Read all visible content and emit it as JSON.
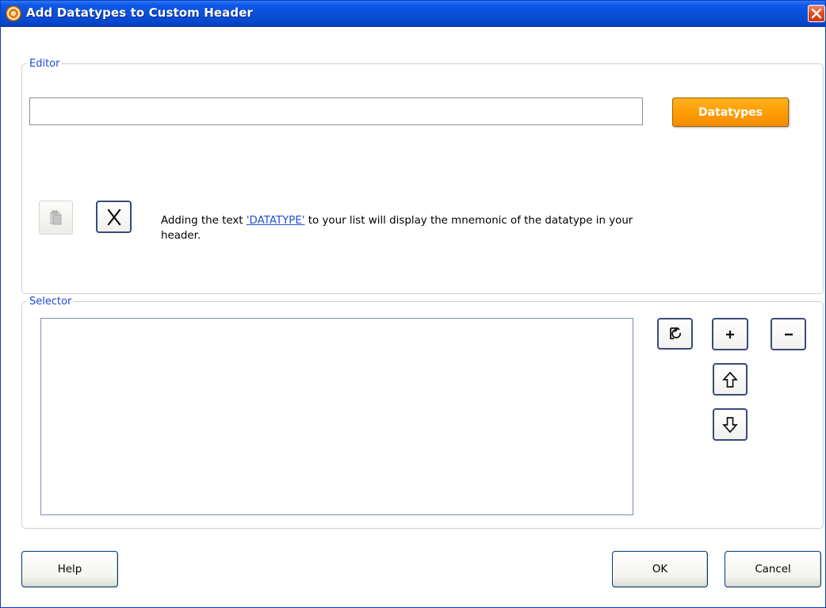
{
  "window": {
    "title": "Add Datatypes to Custom Header"
  },
  "editor": {
    "legend": "Editor",
    "input_value": "",
    "datatypes_label": "Datatypes",
    "info_prefix": "Adding the text ",
    "info_link": "'DATATYPE'",
    "info_suffix": " to your list will display the mnemonic of the datatype in your header."
  },
  "selector": {
    "legend": "Selector",
    "items": []
  },
  "footer": {
    "help_label": "Help",
    "ok_label": "OK",
    "cancel_label": "Cancel"
  },
  "icons": {
    "app": "app-logo-icon",
    "close": "close-icon",
    "paste": "paste-icon",
    "clear": "clear-x-icon",
    "refresh": "refresh-icon",
    "add": "plus-icon",
    "remove": "minus-icon",
    "up": "arrow-up-icon",
    "down": "arrow-down-icon"
  },
  "colors": {
    "titlebar": "#0a4fd8",
    "accent_orange": "#ff9a00",
    "legend_blue": "#1c46d8",
    "link_blue": "#1f4fd0"
  }
}
